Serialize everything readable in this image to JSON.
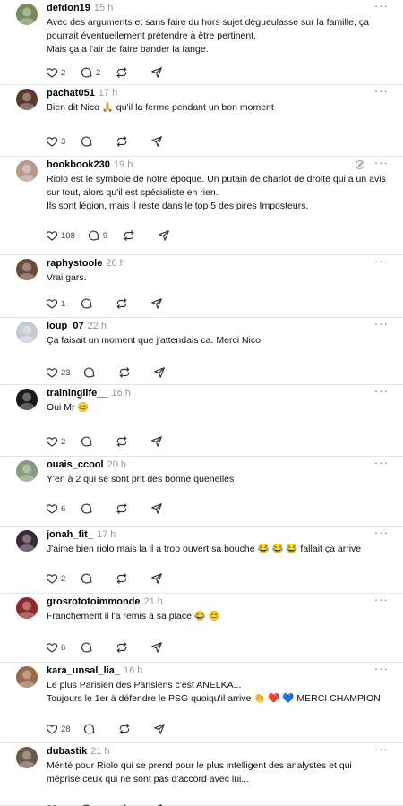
{
  "posts": [
    {
      "username": "defdon19",
      "time": "15 h",
      "lines": [
        "Avec des arguments et sans faire du hors sujet dégueulasse sur la famille, ça",
        "pourrait éventuellement prétendre à être pertinent.",
        "Mais ça a l'air de faire bander la fange."
      ],
      "likes": "2",
      "replies": "2",
      "reposts": "",
      "edit": false,
      "avatar_color": "#7a8a5c"
    },
    {
      "username": "pachat051",
      "time": "17 h",
      "lines": [
        "Bien dit Nico 🙏 qu'il la ferme pendant un bon moment"
      ],
      "likes": "3",
      "replies": "",
      "reposts": "",
      "edit": false,
      "avatar_color": "#5a3a2a"
    },
    {
      "username": "bookbook230",
      "time": "19 h",
      "lines": [
        "Riolo est le symbole de notre époque. Un putain de charlot de droite qui a un avis",
        "sur tout, alors qu'il est spécialiste en rien.",
        "Ils sont légion, mais il reste dans le top 5 des pires Imposteurs."
      ],
      "likes": "108",
      "replies": "9",
      "reposts": "",
      "edit": true,
      "avatar_color": "#b89a88"
    },
    {
      "username": "raphystoole",
      "time": "20 h",
      "lines": [
        "Vrai gars."
      ],
      "likes": "1",
      "replies": "",
      "reposts": "",
      "edit": false,
      "avatar_color": "#6b4a3a"
    },
    {
      "username": "loup_07",
      "time": "22 h",
      "lines": [
        "Ça faisait un moment que j'attendais ca. Merci Nico."
      ],
      "likes": "23",
      "replies": "",
      "reposts": "",
      "edit": false,
      "avatar_color": "#c6cbd3"
    },
    {
      "username": "traininglife__",
      "time": "16 h",
      "lines": [
        "Oui Mr 😊"
      ],
      "likes": "2",
      "replies": "",
      "reposts": "",
      "edit": false,
      "avatar_color": "#1a1a1a"
    },
    {
      "username": "ouais_ccool",
      "time": "20 h",
      "lines": [
        "Y'en à 2 qui se sont prit des bonne quenelles"
      ],
      "likes": "6",
      "replies": "",
      "reposts": "",
      "edit": false,
      "avatar_color": "#8a9a7a"
    },
    {
      "username": "jonah_fit_",
      "time": "17 h",
      "lines": [
        "J'aime bien riolo mais la il a trop ouvert sa bouche 😂 😂 😂 fallait ça arrive"
      ],
      "likes": "2",
      "replies": "",
      "reposts": "",
      "edit": false,
      "avatar_color": "#3a2a3a"
    },
    {
      "username": "grosrototoimmonde",
      "time": "21 h",
      "lines": [
        "Franchement il l'a remis à sa place 😂 😊"
      ],
      "likes": "6",
      "replies": "",
      "reposts": "",
      "edit": false,
      "avatar_color": "#8a2a2a"
    },
    {
      "username": "kara_unsal_lia_",
      "time": "16 h",
      "lines": [
        "Le plus Parisien des Parisiens c'est ANELKA...",
        "Toujours le 1er à défendre le PSG quoiqu'il arrive 👏 ❤️ 💙  MERCI CHAMPION"
      ],
      "likes": "28",
      "replies": "",
      "reposts": "",
      "edit": false,
      "avatar_color": "#9a6a4a"
    },
    {
      "username": "dubastik",
      "time": "21 h",
      "lines": [
        "Mérité pour Riolo qui se prend pour le plus intelligent des analystes et qui",
        "méprise ceux qui ne sont pas d'accord avec lui..."
      ],
      "likes": "",
      "replies": "",
      "reposts": "",
      "edit": false,
      "avatar_color": "#6a5a4a"
    }
  ],
  "icons": {
    "like": "heart-icon",
    "reply": "comment-icon",
    "repost": "repost-icon",
    "share": "send-icon",
    "more": "more-icon",
    "edit": "edit-icon"
  },
  "more_label": "···"
}
